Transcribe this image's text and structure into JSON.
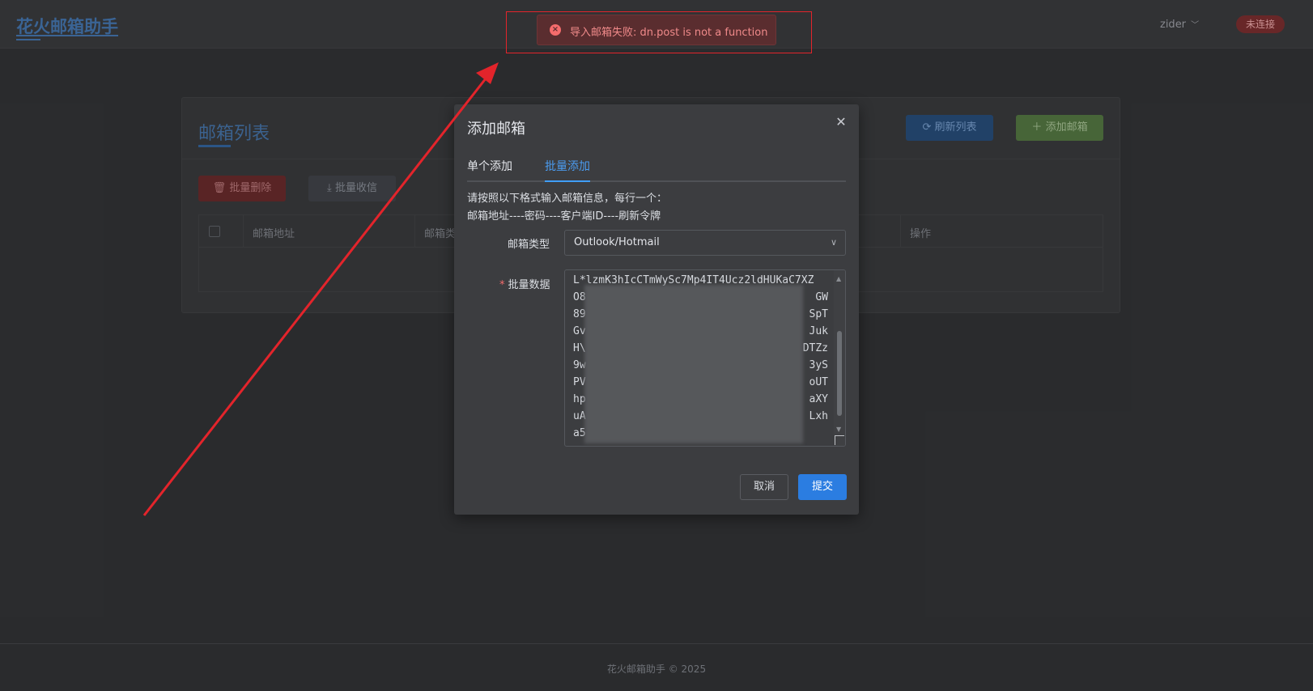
{
  "header": {
    "app_title": "花火邮箱助手",
    "user": "zider",
    "user_chevron": "﹀",
    "connection_status": "未连接"
  },
  "mailbox_card": {
    "title": "邮箱列表",
    "refresh_label": "刷新列表",
    "add_label": "添加邮箱",
    "batch_delete_label": "批量删除",
    "batch_receive_label": "批量收信",
    "columns": [
      "邮箱地址",
      "邮箱类",
      "操作"
    ]
  },
  "dialog": {
    "title": "添加邮箱",
    "close_glyph": "✕",
    "tabs": [
      "单个添加",
      "批量添加"
    ],
    "active_tab": "批量添加",
    "hint_line1": "请按照以下格式输入邮箱信息，每行一个：",
    "hint_line2": "邮箱地址----密码----客户端ID----刷新令牌",
    "type_label": "邮箱类型",
    "type_value": "Outlook/Hotmail",
    "type_arrow": "∨",
    "batch_label": "批量数据",
    "batch_required_mark": "*",
    "batch_lines": [
      {
        "left": "L*lzmK3hIcCTmWySc7Mp4IT4Ucz2ldHUKaC7XZ",
        "right": ""
      },
      {
        "left": "O8",
        "right": "GW"
      },
      {
        "left": "89",
        "right": "SpT"
      },
      {
        "left": "Gv",
        "right": "Juk"
      },
      {
        "left": "H\\",
        "right": "DTZz"
      },
      {
        "left": "9w",
        "right": "3yS"
      },
      {
        "left": "PV",
        "right": "oUT"
      },
      {
        "left": "hp",
        "right": "aXY"
      },
      {
        "left": "uA",
        "right": "Lxh"
      },
      {
        "left": "a5",
        "right": ""
      }
    ],
    "cancel_label": "取消",
    "submit_label": "提交"
  },
  "toast": {
    "type": "error",
    "icon_glyph": "×",
    "message": "导入邮箱失败: dn.post is not a function"
  },
  "footer": {
    "text": "花火邮箱助手 © 2025"
  },
  "colors": {
    "accent": "#409eff",
    "error": "#f56c6c",
    "annotation": "#e3242b",
    "success": "#4b6b3c"
  }
}
